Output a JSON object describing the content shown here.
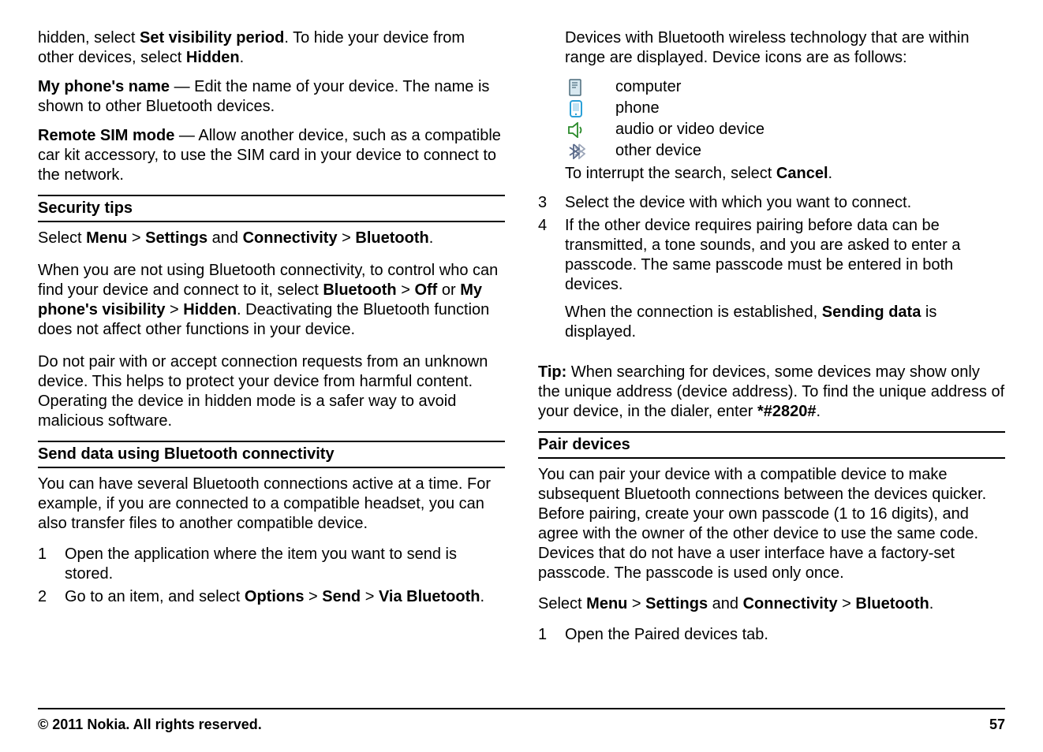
{
  "col1": {
    "p1": {
      "t1": "hidden, select ",
      "b1": "Set visibility period",
      "t2": ". To hide your device from other devices, select ",
      "b2": "Hidden",
      "t3": "."
    },
    "p2": {
      "b1": "My phone's name",
      "t1": "  — Edit the name of your device. The name is shown to other Bluetooth devices."
    },
    "p3": {
      "b1": "Remote SIM mode",
      "t1": "  — Allow another device, such as a compatible car kit accessory, to use the SIM card in your device to connect to the network."
    },
    "h1": "Security tips",
    "p4": {
      "t1": "Select ",
      "b1": "Menu",
      "t2": " > ",
      "b2": "Settings",
      "t3": " and ",
      "b3": "Connectivity",
      "t4": " > ",
      "b4": "Bluetooth",
      "t5": "."
    },
    "p5": {
      "t1": "When you are not using Bluetooth connectivity, to control who can find your device and connect to it, select ",
      "b1": "Bluetooth",
      "t2": " > ",
      "b2": "Off",
      "t3": " or ",
      "b3": "My phone's visibility",
      "t4": " > ",
      "b4": "Hidden",
      "t5": ". Deactivating the Bluetooth function does not affect other functions in your device."
    },
    "p6": "Do not pair with or accept connection requests from an unknown device. This helps to protect your device from harmful content. Operating the device in hidden mode is a safer way to avoid malicious software.",
    "h2": "Send data using Bluetooth connectivity",
    "p7": "You can have several Bluetooth connections active at a time. For example, if you are connected to a compatible headset, you can also transfer files to another compatible device.",
    "ol1": {
      "n1": "1",
      "i1": "Open the application where the item you want to send is stored.",
      "n2": "2",
      "i2": {
        "t1": "Go to an item, and select ",
        "b1": "Options",
        "t2": " > ",
        "b2": "Send",
        "t3": " > ",
        "b3": "Via Bluetooth",
        "t4": "."
      }
    }
  },
  "col2": {
    "p1": "Devices with Bluetooth wireless technology that are within range are displayed. Device icons are as follows:",
    "icons": {
      "computer": "computer",
      "phone": "phone",
      "audio": "audio or video device",
      "other": "other device"
    },
    "p2": {
      "t1": "To interrupt the search, select ",
      "b1": "Cancel",
      "t2": "."
    },
    "ol1": {
      "n3": "3",
      "i3": "Select the device with which you want to connect.",
      "n4": "4",
      "i4": "If the other device requires pairing before data can be transmitted, a tone sounds, and you are asked to enter a passcode. The same passcode must be entered in both devices.",
      "i4b": {
        "t1": "When the connection is established, ",
        "b1": "Sending data",
        "t2": " is displayed."
      }
    },
    "tip": {
      "b1": "Tip:",
      "t1": " When searching for devices, some devices may show only the unique address (device address). To find the unique address of your device, in the dialer, enter ",
      "b2": "*#2820#",
      "t2": "."
    },
    "h1": "Pair devices",
    "p3": "You can pair your device with a compatible device to make subsequent Bluetooth connections between the devices quicker. Before pairing, create your own passcode (1 to 16 digits), and agree with the owner of the other device to use the same code. Devices that do not have a user interface have a factory-set passcode. The passcode is used only once.",
    "p4": {
      "t1": "Select ",
      "b1": "Menu",
      "t2": " > ",
      "b2": "Settings",
      "t3": " and ",
      "b3": "Connectivity",
      "t4": " > ",
      "b4": "Bluetooth",
      "t5": "."
    },
    "ol2": {
      "n1": "1",
      "i1": "Open the Paired devices tab."
    }
  },
  "footer": {
    "copyright": "© 2011 Nokia. All rights reserved.",
    "page": "57"
  }
}
